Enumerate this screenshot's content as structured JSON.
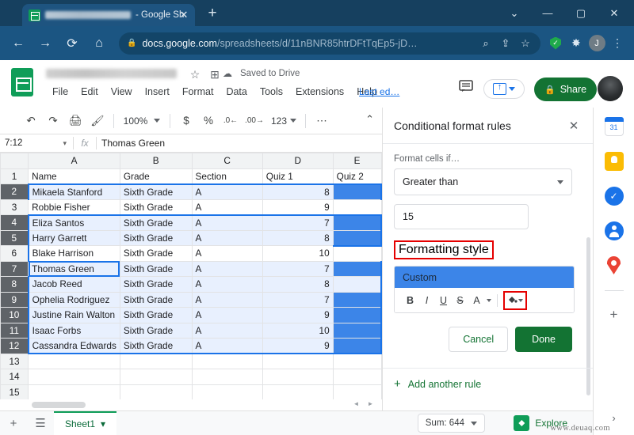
{
  "browser": {
    "tab_title": "- Google Sh",
    "tab_close": "✕",
    "new_tab": "+",
    "window_controls": {
      "minimize_menu": "⌄",
      "minimize": "—",
      "maximize": "▢",
      "close": "✕"
    },
    "nav": {
      "back": "←",
      "forward": "→",
      "reload": "⟳",
      "home": "⌂"
    },
    "url_domain": "docs.google.com",
    "url_path": "/spreadsheets/d/11nBNR85htrDFtTqEp5-jD…",
    "lock": "🔒",
    "omnibox_icons": {
      "zoom_search": "⌕",
      "share": "⇪",
      "bookmark": "☆"
    },
    "extensions": {
      "shield": "shield-check",
      "puzzle": "✸",
      "profile_initial": "J",
      "menu": "⋮"
    }
  },
  "sheets": {
    "saved_status": "Saved to Drive",
    "star": "☆",
    "move_to_folder": "⊞",
    "cloud": "☁",
    "menus": [
      "File",
      "Edit",
      "View",
      "Insert",
      "Format",
      "Data",
      "Tools",
      "Extensions",
      "Help"
    ],
    "last_edit": "Last ed…",
    "comment_icon": "💬",
    "share_label": "Share",
    "toolbar": {
      "undo": "↶",
      "redo": "↷",
      "print": "🖨",
      "paint": "🖌",
      "zoom_value": "100%",
      "currency": "$",
      "percent": "%",
      "dec_decrease": ".0←",
      "dec_increase": ".00→",
      "formats": "123",
      "more": "⋯",
      "collapse": "⌃"
    },
    "namebox": "7:12",
    "fx_label": "fx",
    "formula_value": "Thomas Green"
  },
  "grid": {
    "columns": [
      "A",
      "B",
      "C",
      "D",
      "E"
    ],
    "headers": [
      "Name",
      "Grade",
      "Section",
      "Quiz 1",
      "Quiz 2"
    ],
    "rows": [
      {
        "n": "1",
        "name": "Name",
        "grade": "Grade",
        "section": "Section",
        "quiz1": "Quiz 1",
        "quiz2": "Quiz 2",
        "selected": false,
        "filled": false
      },
      {
        "n": "2",
        "name": "Mikaela Stanford",
        "grade": "Sixth Grade",
        "section": "A",
        "quiz1": "8",
        "quiz2": "",
        "selected": true,
        "filled": true
      },
      {
        "n": "3",
        "name": "Robbie Fisher",
        "grade": "Sixth Grade",
        "section": "A",
        "quiz1": "9",
        "quiz2": "",
        "selected": false,
        "filled": false
      },
      {
        "n": "4",
        "name": "Eliza Santos",
        "grade": "Sixth Grade",
        "section": "A",
        "quiz1": "7",
        "quiz2": "",
        "selected": true,
        "filled": true
      },
      {
        "n": "5",
        "name": "Harry Garrett",
        "grade": "Sixth Grade",
        "section": "A",
        "quiz1": "8",
        "quiz2": "",
        "selected": true,
        "filled": true
      },
      {
        "n": "6",
        "name": "Blake Harrison",
        "grade": "Sixth Grade",
        "section": "A",
        "quiz1": "10",
        "quiz2": "",
        "selected": false,
        "filled": false
      },
      {
        "n": "7",
        "name": "Thomas Green",
        "grade": "Sixth Grade",
        "section": "A",
        "quiz1": "7",
        "quiz2": "",
        "selected": true,
        "filled": true
      },
      {
        "n": "8",
        "name": "Jacob Reed",
        "grade": "Sixth Grade",
        "section": "A",
        "quiz1": "8",
        "quiz2": "",
        "selected": true,
        "filled": false
      },
      {
        "n": "9",
        "name": "Ophelia Rodriguez",
        "grade": "Sixth Grade",
        "section": "A",
        "quiz1": "7",
        "quiz2": "",
        "selected": true,
        "filled": true
      },
      {
        "n": "10",
        "name": "Justine Rain Walton",
        "grade": "Sixth Grade",
        "section": "A",
        "quiz1": "9",
        "quiz2": "",
        "selected": true,
        "filled": true
      },
      {
        "n": "11",
        "name": "Isaac Forbs",
        "grade": "Sixth Grade",
        "section": "A",
        "quiz1": "10",
        "quiz2": "",
        "selected": true,
        "filled": true
      },
      {
        "n": "12",
        "name": "Cassandra Edwards",
        "grade": "Sixth Grade",
        "section": "A",
        "quiz1": "9",
        "quiz2": "",
        "selected": true,
        "filled": true
      },
      {
        "n": "13",
        "name": "",
        "grade": "",
        "section": "",
        "quiz1": "",
        "quiz2": "",
        "selected": false,
        "filled": false
      },
      {
        "n": "14",
        "name": "",
        "grade": "",
        "section": "",
        "quiz1": "",
        "quiz2": "",
        "selected": false,
        "filled": false
      },
      {
        "n": "15",
        "name": "",
        "grade": "",
        "section": "",
        "quiz1": "",
        "quiz2": "",
        "selected": false,
        "filled": false
      }
    ],
    "active_cell_row": "7",
    "fill_color": "#3c85e8",
    "selection_tint": "#e8f0fe"
  },
  "panel": {
    "title": "Conditional format rules",
    "close": "✕",
    "format_cells_if_label": "Format cells if…",
    "condition_value": "Greater than",
    "threshold_value": "15",
    "formatting_style_label": "Formatting style",
    "style_preview_text": "Custom",
    "style_tools": {
      "bold": "B",
      "italic": "I",
      "underline": "U",
      "strikethrough": "S",
      "text_color": "A",
      "fill_color": "▲"
    },
    "cancel_label": "Cancel",
    "done_label": "Done",
    "add_rule_plus": "+",
    "add_rule_label": "Add another rule"
  },
  "rail": {
    "calendar": "calendar-icon",
    "keep": "keep-icon",
    "tasks": "tasks-icon",
    "contacts": "contacts-icon",
    "maps": "maps-icon",
    "add_ons": "+",
    "collapse": "›"
  },
  "bottom": {
    "add_sheet": "+",
    "all_sheets": "☰",
    "sheet_name": "Sheet1",
    "sheet_caret": "▾",
    "sum_label": "Sum: 644",
    "sum_caret": "▾",
    "explore_label": "Explore",
    "watermark": "www.deuaq.com"
  }
}
